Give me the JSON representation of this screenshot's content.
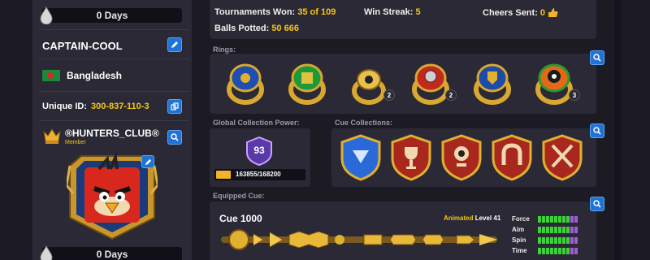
{
  "profile": {
    "top_days": "0 Days",
    "username": "CAPTAIN-COOL",
    "country": "Bangladesh",
    "unique_id_label": "Unique ID:",
    "unique_id_value": "300-837-110-3",
    "club_name": "®HUNTERS_CLUB®",
    "club_role": "Member",
    "bottom_days": "0 Days"
  },
  "stats": {
    "tournaments_label": "Tournaments Won:",
    "tournaments_value": "35 of 109",
    "streak_label": "Win Streak:",
    "streak_value": "5",
    "cheers_label": "Cheers Sent:",
    "cheers_value": "0",
    "balls_label": "Balls Potted:",
    "balls_value": "50 666"
  },
  "rings": {
    "title": "Rings:",
    "items": [
      {
        "icon": "blue-gold-ring-icon",
        "count": ""
      },
      {
        "icon": "green-gold-ring-icon",
        "count": ""
      },
      {
        "icon": "gold-8ball-ring-icon",
        "count": "2"
      },
      {
        "icon": "red-film-ring-icon",
        "count": "2"
      },
      {
        "icon": "blue-crest-ring-icon",
        "count": ""
      },
      {
        "icon": "8ball-flame-ring-icon",
        "count": "3"
      }
    ]
  },
  "global_power": {
    "title": "Global Collection Power:",
    "level": "93",
    "progress": "163855/168200",
    "progress_fraction": 0.974
  },
  "cue_collections": {
    "title": "Cue Collections:",
    "items": [
      "rack-shield-icon",
      "trophy-shield-icon",
      "cup-8-shield-icon",
      "horseshoe-shield-icon",
      "crossed-swords-shield-icon"
    ]
  },
  "equipped": {
    "title": "Equipped Cue:",
    "cue_name": "Cue 1000",
    "animated_label": "Animated",
    "level_label": "Level 41",
    "attributes": [
      {
        "name": "Force",
        "green": 8,
        "purple": 2
      },
      {
        "name": "Aim",
        "green": 8,
        "purple": 2
      },
      {
        "name": "Spin",
        "green": 8,
        "purple": 2
      },
      {
        "name": "Time",
        "green": 8,
        "purple": 2
      }
    ]
  },
  "colors": {
    "accent": "#f5c518",
    "button": "#1f73d8",
    "panel": "#2a2935",
    "bar_green": "#3dd13a",
    "bar_purple": "#a05bd8"
  }
}
